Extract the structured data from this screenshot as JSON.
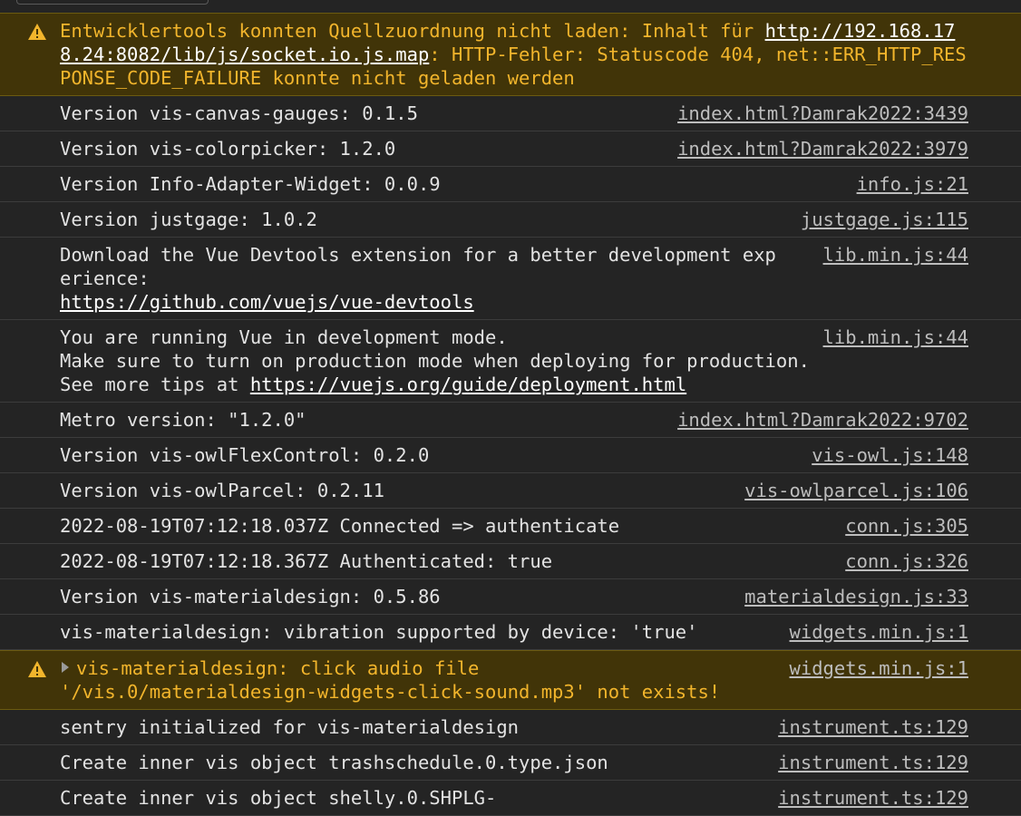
{
  "entries": [
    {
      "kind": "warning",
      "text_before": "Entwicklertools konnten Quellzuordnung nicht laden: Inhalt für ",
      "link": "http://192.168.178.24:8082/lib/js/socket.io.js.map",
      "text_after": ": HTTP-Fehler: Statuscode 404, net::ERR_HTTP_RESPONSE_CODE_FAILURE konnte nicht geladen werden"
    },
    {
      "kind": "log",
      "text": "Version vis-canvas-gauges: 0.1.5",
      "source": "index.html?Damrak2022:3439"
    },
    {
      "kind": "log",
      "text": "Version vis-colorpicker: 1.2.0",
      "source": "index.html?Damrak2022:3979"
    },
    {
      "kind": "log",
      "text": "Version Info-Adapter-Widget: 0.0.9",
      "source": "info.js:21"
    },
    {
      "kind": "log",
      "text": "Version justgage: 1.0.2",
      "source": "justgage.js:115"
    },
    {
      "kind": "log",
      "line1": "Download the Vue Devtools extension for a better development experience:",
      "link": "https://github.com/vuejs/vue-devtools",
      "source": "lib.min.js:44"
    },
    {
      "kind": "log",
      "line1": "You are running Vue in development mode.",
      "line2": "Make sure to turn on production mode when deploying for production.",
      "line3_prefix": "See more tips at ",
      "link": "https://vuejs.org/guide/deployment.html",
      "source": "lib.min.js:44"
    },
    {
      "kind": "log",
      "text": "Metro version: \"1.2.0\"",
      "source": "index.html?Damrak2022:9702"
    },
    {
      "kind": "log",
      "text": "Version vis-owlFlexControl: 0.2.0",
      "source": "vis-owl.js:148"
    },
    {
      "kind": "log",
      "text": "Version vis-owlParcel: 0.2.11",
      "source": "vis-owlparcel.js:106"
    },
    {
      "kind": "log",
      "text": "2022-08-19T07:12:18.037Z Connected => authenticate",
      "source": "conn.js:305"
    },
    {
      "kind": "log",
      "text": "2022-08-19T07:12:18.367Z Authenticated: true",
      "source": "conn.js:326"
    },
    {
      "kind": "log",
      "text": "Version vis-materialdesign: 0.5.86",
      "source": "materialdesign.js:33"
    },
    {
      "kind": "log",
      "text": "vis-materialdesign: vibration supported by device: 'true'",
      "source": "widgets.min.js:1"
    },
    {
      "kind": "warning",
      "line1": "vis-materialdesign: click audio file",
      "line2": "'/vis.0/materialdesign-widgets-click-sound.mp3' not exists!",
      "source": "widgets.min.js:1"
    },
    {
      "kind": "log",
      "text": "sentry initialized for vis-materialdesign",
      "source": "instrument.ts:129"
    },
    {
      "kind": "log",
      "text": "Create inner vis object trashschedule.0.type.json",
      "source": "instrument.ts:129"
    },
    {
      "kind": "log",
      "line1": "Create inner vis object shelly.0.SHPLG-",
      "source": "instrument.ts:129"
    }
  ],
  "colors": {
    "background": "#242424",
    "warning_bg": "#413408",
    "warning_text": "#f2b52c",
    "log_text": "#e3e3e3",
    "source_text": "#bdbdbd"
  },
  "icons": {
    "warning": "warning-icon",
    "expand": "expand-triangle-icon"
  }
}
